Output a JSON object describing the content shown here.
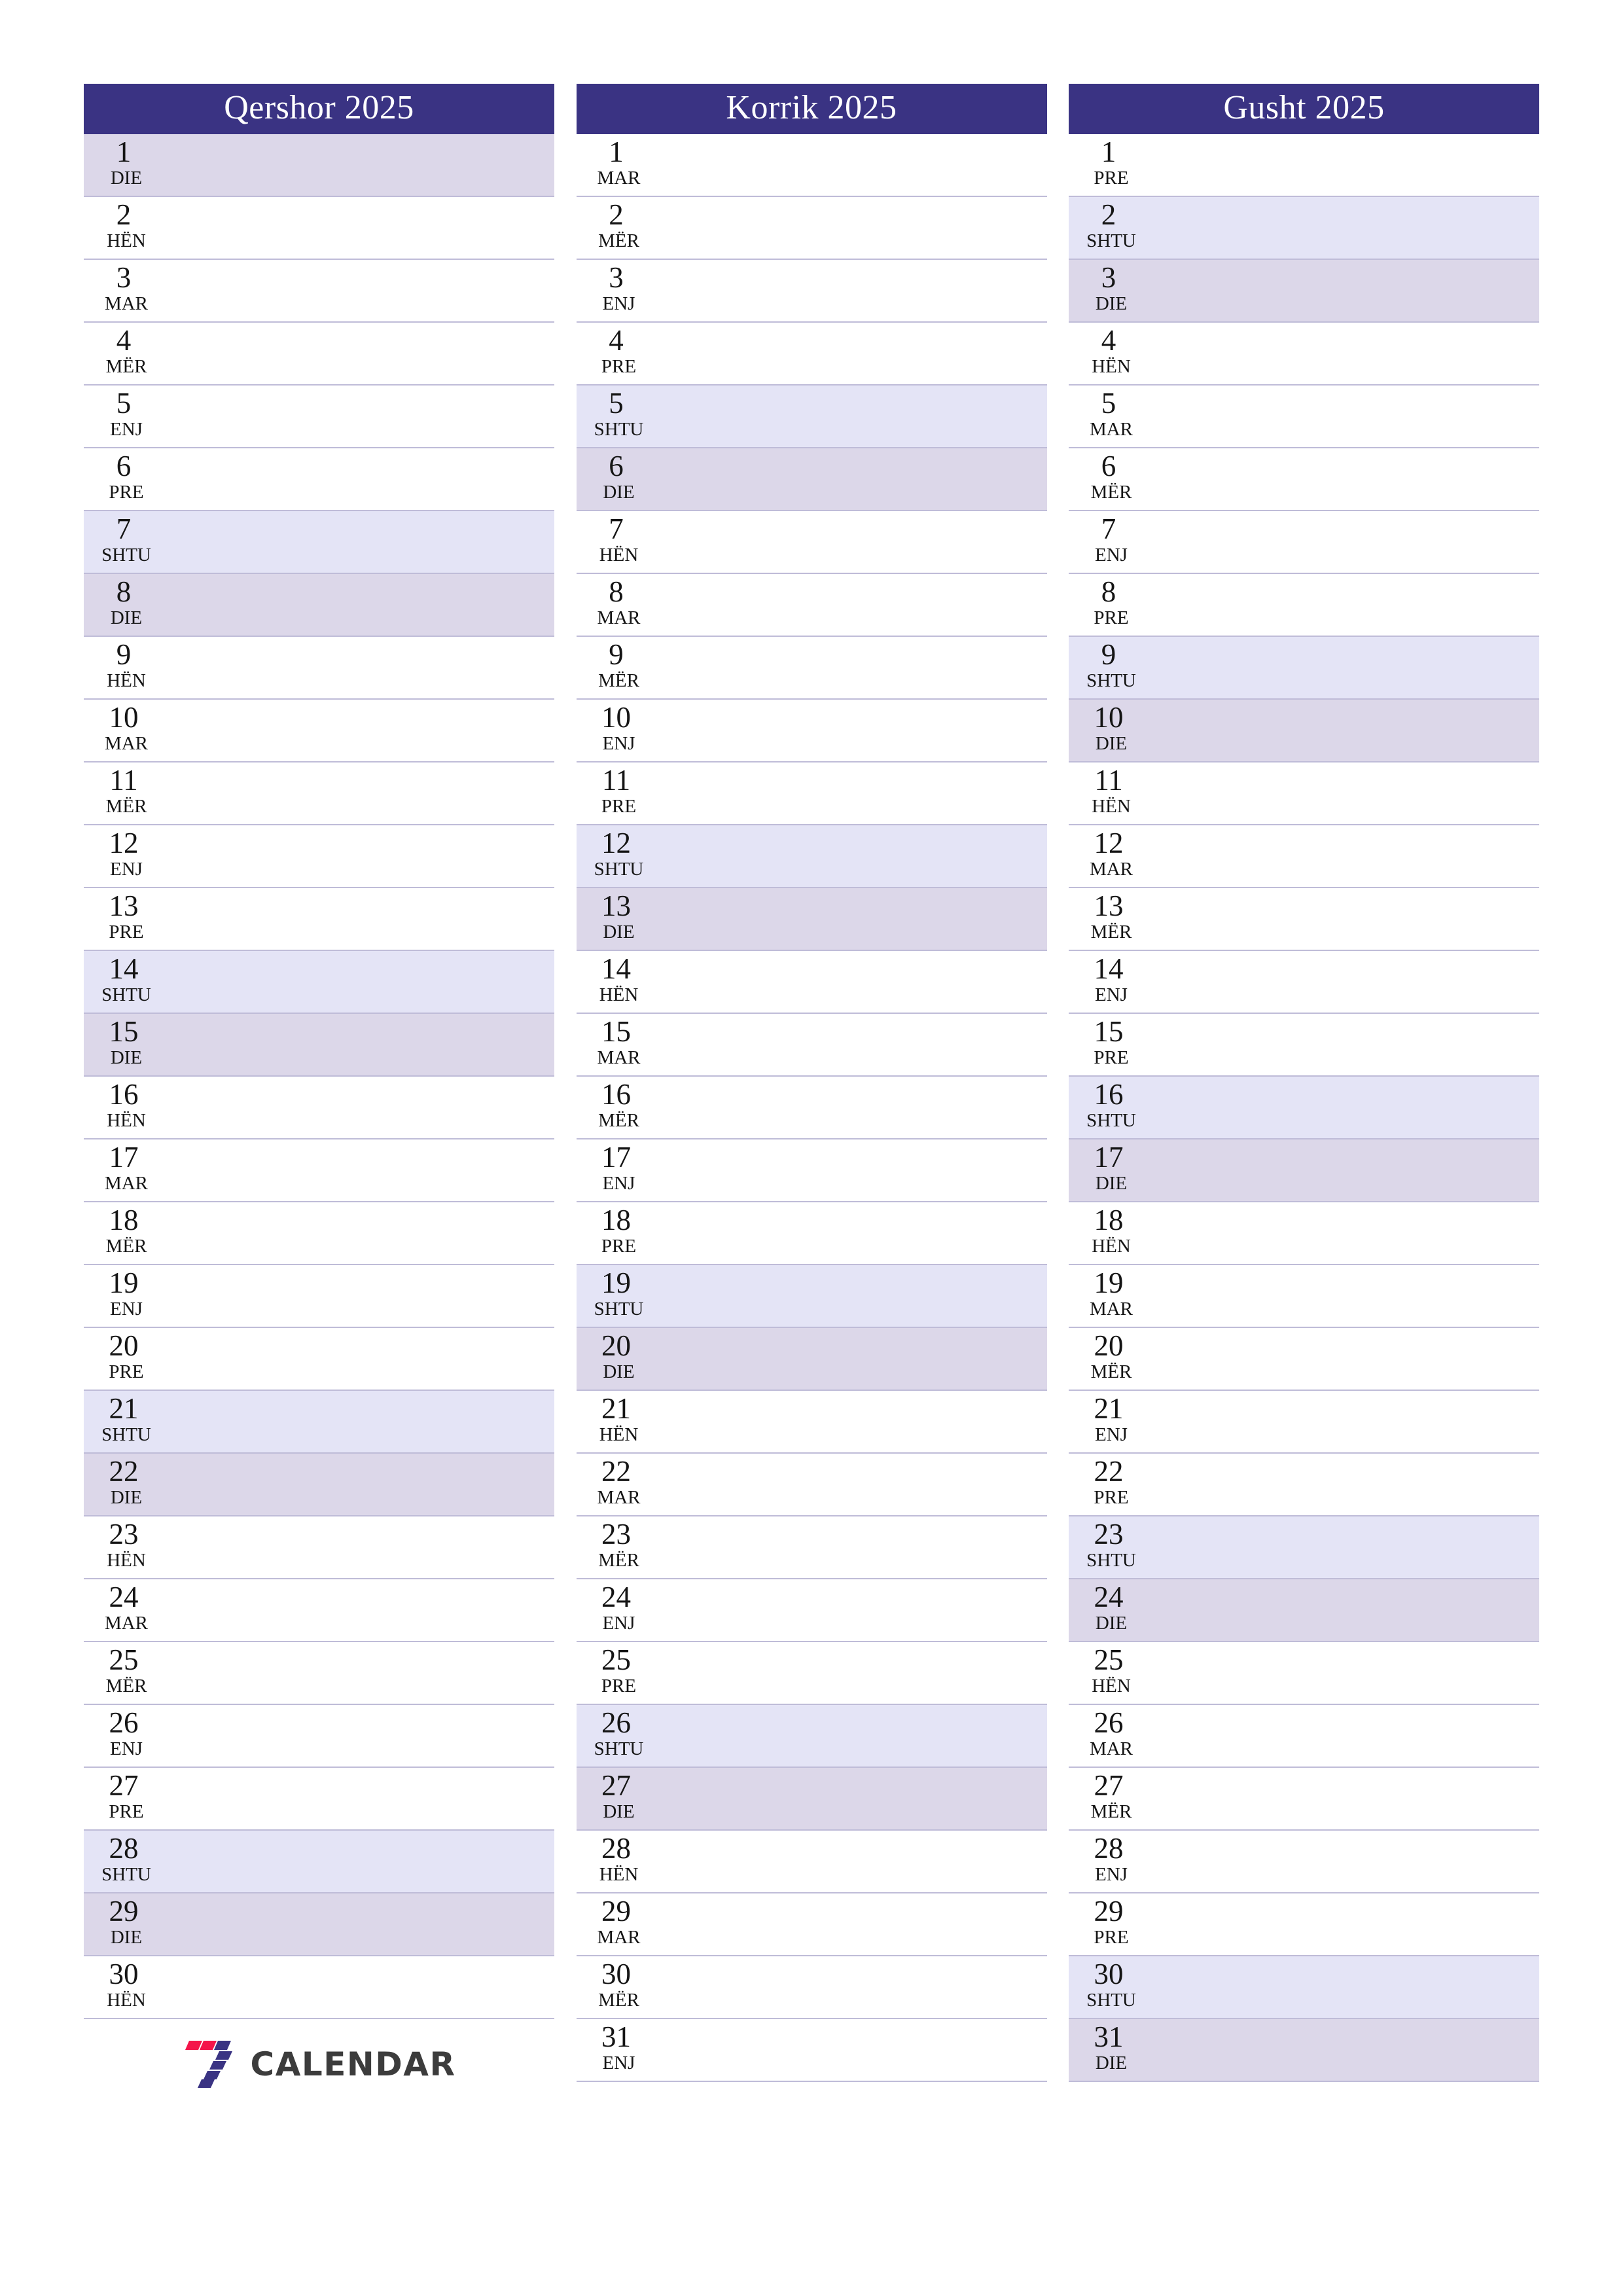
{
  "page": {
    "background": "#ffffff",
    "header_color": "#3a3383",
    "saturday_color": "#e4e4f6",
    "sunday_color": "#dcd7e9",
    "row_border_color": "#bfbcd8"
  },
  "brand": {
    "name": "CALENDAR",
    "mark": "seven-logo-icon",
    "mark_colors": [
      "#f4154a",
      "#3a3383"
    ]
  },
  "months": [
    {
      "title": "Qershor 2025",
      "days": [
        {
          "num": "1",
          "abbr": "DIE",
          "type": "sun"
        },
        {
          "num": "2",
          "abbr": "HËN",
          "type": "week"
        },
        {
          "num": "3",
          "abbr": "MAR",
          "type": "week"
        },
        {
          "num": "4",
          "abbr": "MËR",
          "type": "week"
        },
        {
          "num": "5",
          "abbr": "ENJ",
          "type": "week"
        },
        {
          "num": "6",
          "abbr": "PRE",
          "type": "week"
        },
        {
          "num": "7",
          "abbr": "SHTU",
          "type": "sat"
        },
        {
          "num": "8",
          "abbr": "DIE",
          "type": "sun"
        },
        {
          "num": "9",
          "abbr": "HËN",
          "type": "week"
        },
        {
          "num": "10",
          "abbr": "MAR",
          "type": "week"
        },
        {
          "num": "11",
          "abbr": "MËR",
          "type": "week"
        },
        {
          "num": "12",
          "abbr": "ENJ",
          "type": "week"
        },
        {
          "num": "13",
          "abbr": "PRE",
          "type": "week"
        },
        {
          "num": "14",
          "abbr": "SHTU",
          "type": "sat"
        },
        {
          "num": "15",
          "abbr": "DIE",
          "type": "sun"
        },
        {
          "num": "16",
          "abbr": "HËN",
          "type": "week"
        },
        {
          "num": "17",
          "abbr": "MAR",
          "type": "week"
        },
        {
          "num": "18",
          "abbr": "MËR",
          "type": "week"
        },
        {
          "num": "19",
          "abbr": "ENJ",
          "type": "week"
        },
        {
          "num": "20",
          "abbr": "PRE",
          "type": "week"
        },
        {
          "num": "21",
          "abbr": "SHTU",
          "type": "sat"
        },
        {
          "num": "22",
          "abbr": "DIE",
          "type": "sun"
        },
        {
          "num": "23",
          "abbr": "HËN",
          "type": "week"
        },
        {
          "num": "24",
          "abbr": "MAR",
          "type": "week"
        },
        {
          "num": "25",
          "abbr": "MËR",
          "type": "week"
        },
        {
          "num": "26",
          "abbr": "ENJ",
          "type": "week"
        },
        {
          "num": "27",
          "abbr": "PRE",
          "type": "week"
        },
        {
          "num": "28",
          "abbr": "SHTU",
          "type": "sat"
        },
        {
          "num": "29",
          "abbr": "DIE",
          "type": "sun"
        },
        {
          "num": "30",
          "abbr": "HËN",
          "type": "week"
        }
      ],
      "has_brand": true
    },
    {
      "title": "Korrik 2025",
      "days": [
        {
          "num": "1",
          "abbr": "MAR",
          "type": "week"
        },
        {
          "num": "2",
          "abbr": "MËR",
          "type": "week"
        },
        {
          "num": "3",
          "abbr": "ENJ",
          "type": "week"
        },
        {
          "num": "4",
          "abbr": "PRE",
          "type": "week"
        },
        {
          "num": "5",
          "abbr": "SHTU",
          "type": "sat"
        },
        {
          "num": "6",
          "abbr": "DIE",
          "type": "sun"
        },
        {
          "num": "7",
          "abbr": "HËN",
          "type": "week"
        },
        {
          "num": "8",
          "abbr": "MAR",
          "type": "week"
        },
        {
          "num": "9",
          "abbr": "MËR",
          "type": "week"
        },
        {
          "num": "10",
          "abbr": "ENJ",
          "type": "week"
        },
        {
          "num": "11",
          "abbr": "PRE",
          "type": "week"
        },
        {
          "num": "12",
          "abbr": "SHTU",
          "type": "sat"
        },
        {
          "num": "13",
          "abbr": "DIE",
          "type": "sun"
        },
        {
          "num": "14",
          "abbr": "HËN",
          "type": "week"
        },
        {
          "num": "15",
          "abbr": "MAR",
          "type": "week"
        },
        {
          "num": "16",
          "abbr": "MËR",
          "type": "week"
        },
        {
          "num": "17",
          "abbr": "ENJ",
          "type": "week"
        },
        {
          "num": "18",
          "abbr": "PRE",
          "type": "week"
        },
        {
          "num": "19",
          "abbr": "SHTU",
          "type": "sat"
        },
        {
          "num": "20",
          "abbr": "DIE",
          "type": "sun"
        },
        {
          "num": "21",
          "abbr": "HËN",
          "type": "week"
        },
        {
          "num": "22",
          "abbr": "MAR",
          "type": "week"
        },
        {
          "num": "23",
          "abbr": "MËR",
          "type": "week"
        },
        {
          "num": "24",
          "abbr": "ENJ",
          "type": "week"
        },
        {
          "num": "25",
          "abbr": "PRE",
          "type": "week"
        },
        {
          "num": "26",
          "abbr": "SHTU",
          "type": "sat"
        },
        {
          "num": "27",
          "abbr": "DIE",
          "type": "sun"
        },
        {
          "num": "28",
          "abbr": "HËN",
          "type": "week"
        },
        {
          "num": "29",
          "abbr": "MAR",
          "type": "week"
        },
        {
          "num": "30",
          "abbr": "MËR",
          "type": "week"
        },
        {
          "num": "31",
          "abbr": "ENJ",
          "type": "week"
        }
      ],
      "has_brand": false
    },
    {
      "title": "Gusht 2025",
      "days": [
        {
          "num": "1",
          "abbr": "PRE",
          "type": "week"
        },
        {
          "num": "2",
          "abbr": "SHTU",
          "type": "sat"
        },
        {
          "num": "3",
          "abbr": "DIE",
          "type": "sun"
        },
        {
          "num": "4",
          "abbr": "HËN",
          "type": "week"
        },
        {
          "num": "5",
          "abbr": "MAR",
          "type": "week"
        },
        {
          "num": "6",
          "abbr": "MËR",
          "type": "week"
        },
        {
          "num": "7",
          "abbr": "ENJ",
          "type": "week"
        },
        {
          "num": "8",
          "abbr": "PRE",
          "type": "week"
        },
        {
          "num": "9",
          "abbr": "SHTU",
          "type": "sat"
        },
        {
          "num": "10",
          "abbr": "DIE",
          "type": "sun"
        },
        {
          "num": "11",
          "abbr": "HËN",
          "type": "week"
        },
        {
          "num": "12",
          "abbr": "MAR",
          "type": "week"
        },
        {
          "num": "13",
          "abbr": "MËR",
          "type": "week"
        },
        {
          "num": "14",
          "abbr": "ENJ",
          "type": "week"
        },
        {
          "num": "15",
          "abbr": "PRE",
          "type": "week"
        },
        {
          "num": "16",
          "abbr": "SHTU",
          "type": "sat"
        },
        {
          "num": "17",
          "abbr": "DIE",
          "type": "sun"
        },
        {
          "num": "18",
          "abbr": "HËN",
          "type": "week"
        },
        {
          "num": "19",
          "abbr": "MAR",
          "type": "week"
        },
        {
          "num": "20",
          "abbr": "MËR",
          "type": "week"
        },
        {
          "num": "21",
          "abbr": "ENJ",
          "type": "week"
        },
        {
          "num": "22",
          "abbr": "PRE",
          "type": "week"
        },
        {
          "num": "23",
          "abbr": "SHTU",
          "type": "sat"
        },
        {
          "num": "24",
          "abbr": "DIE",
          "type": "sun"
        },
        {
          "num": "25",
          "abbr": "HËN",
          "type": "week"
        },
        {
          "num": "26",
          "abbr": "MAR",
          "type": "week"
        },
        {
          "num": "27",
          "abbr": "MËR",
          "type": "week"
        },
        {
          "num": "28",
          "abbr": "ENJ",
          "type": "week"
        },
        {
          "num": "29",
          "abbr": "PRE",
          "type": "week"
        },
        {
          "num": "30",
          "abbr": "SHTU",
          "type": "sat"
        },
        {
          "num": "31",
          "abbr": "DIE",
          "type": "sun"
        }
      ],
      "has_brand": false
    }
  ]
}
